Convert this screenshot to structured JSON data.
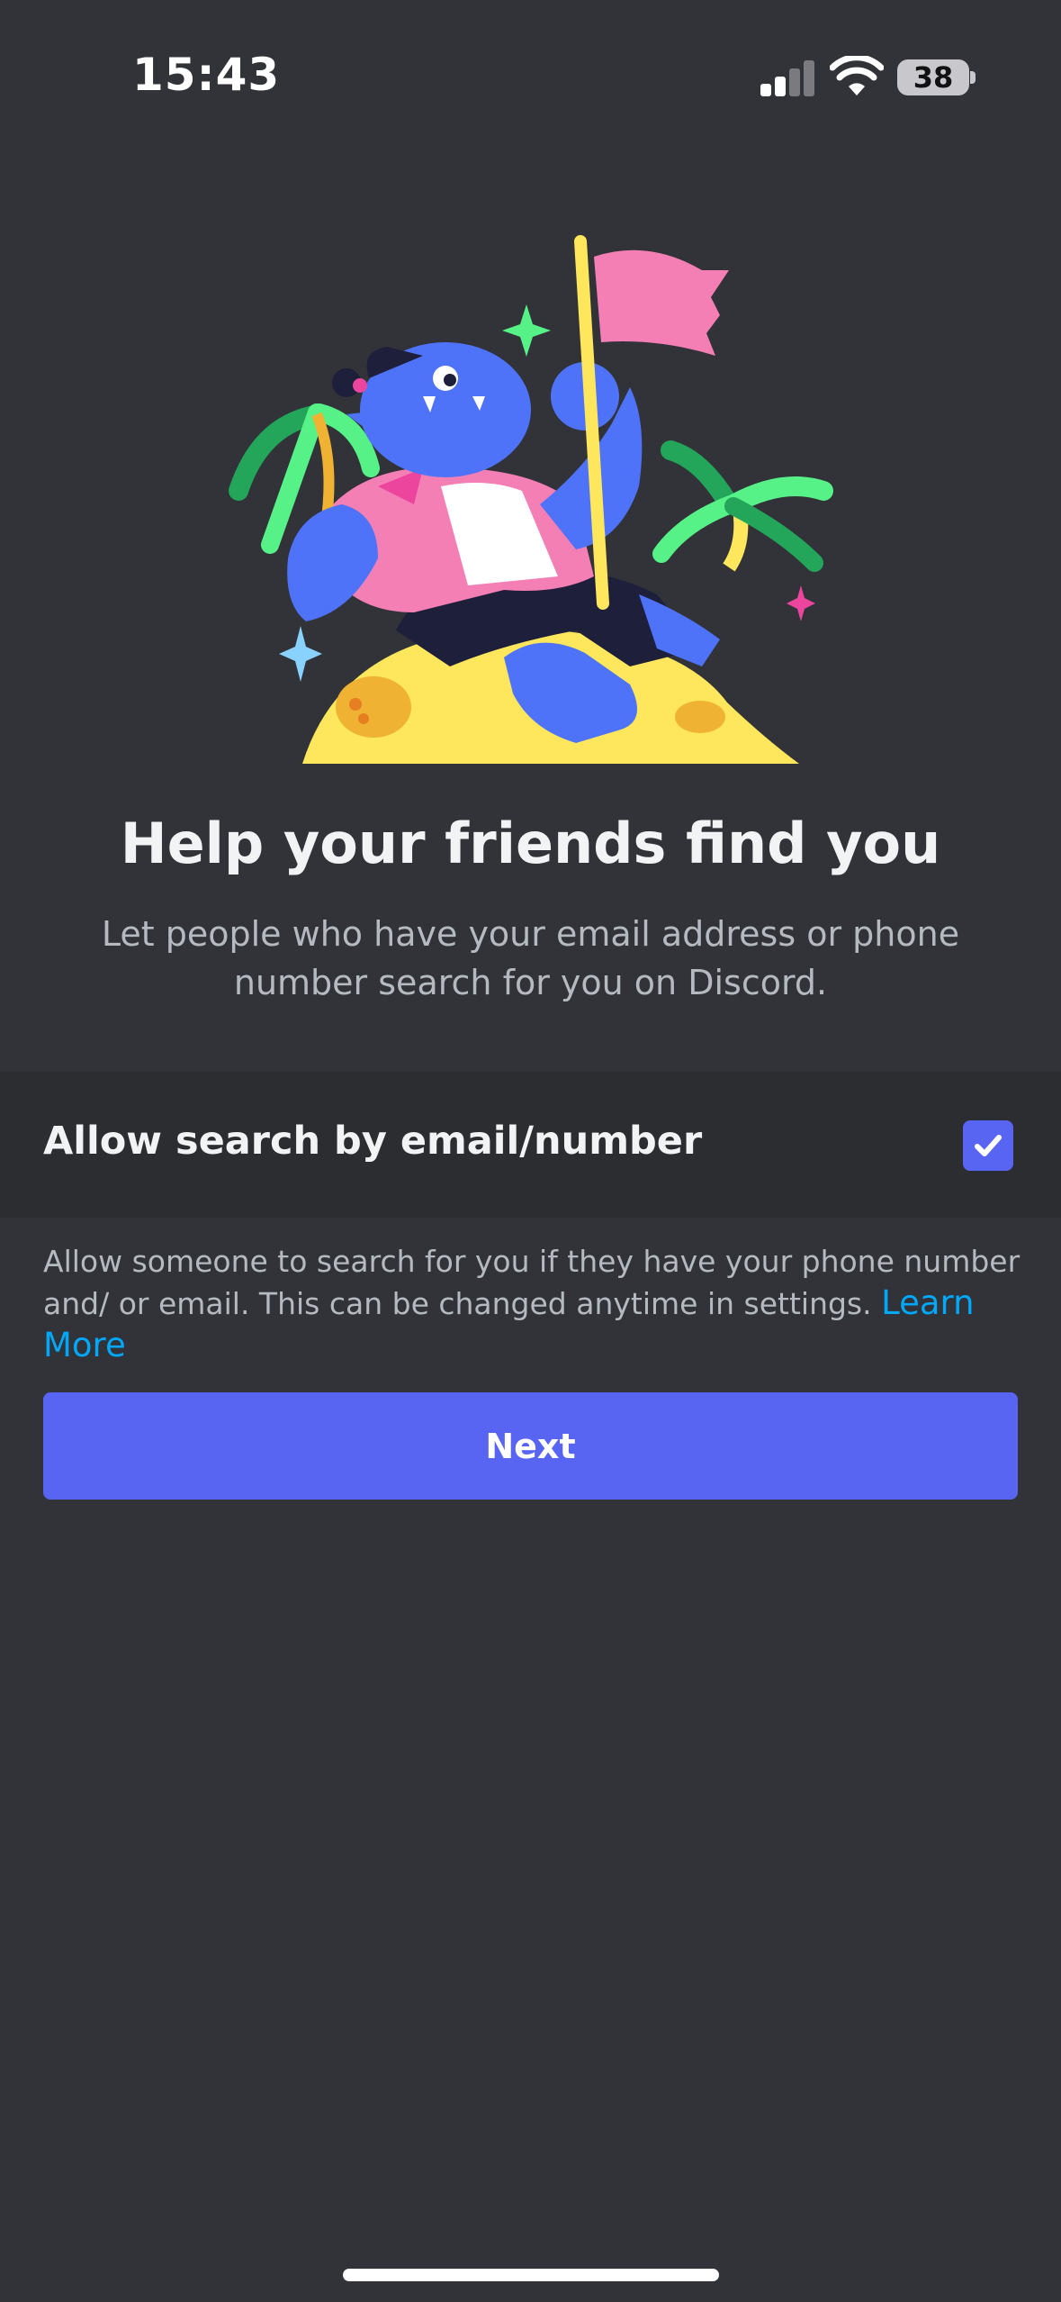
{
  "status_bar": {
    "time": "15:43",
    "battery": "38",
    "icons": [
      "cellular-signal-icon",
      "wifi-icon",
      "battery-icon"
    ]
  },
  "hero": {
    "illustration": "character-with-flag-on-island"
  },
  "content": {
    "title": "Help your friends find you",
    "subtitle": "Let people who have your email address or phone number search for you on Discord."
  },
  "setting": {
    "label": "Allow search by email/number",
    "checked": true,
    "description": "Allow someone to search for you if they have your phone number and/ or email. This can be changed anytime in settings.",
    "learn_more": "Learn More"
  },
  "actions": {
    "next_label": "Next"
  },
  "colors": {
    "background": "#313338",
    "row_background": "#2b2d31",
    "brand": "#5865f2",
    "link": "#00a8fc",
    "muted_text": "#b5bac1"
  }
}
